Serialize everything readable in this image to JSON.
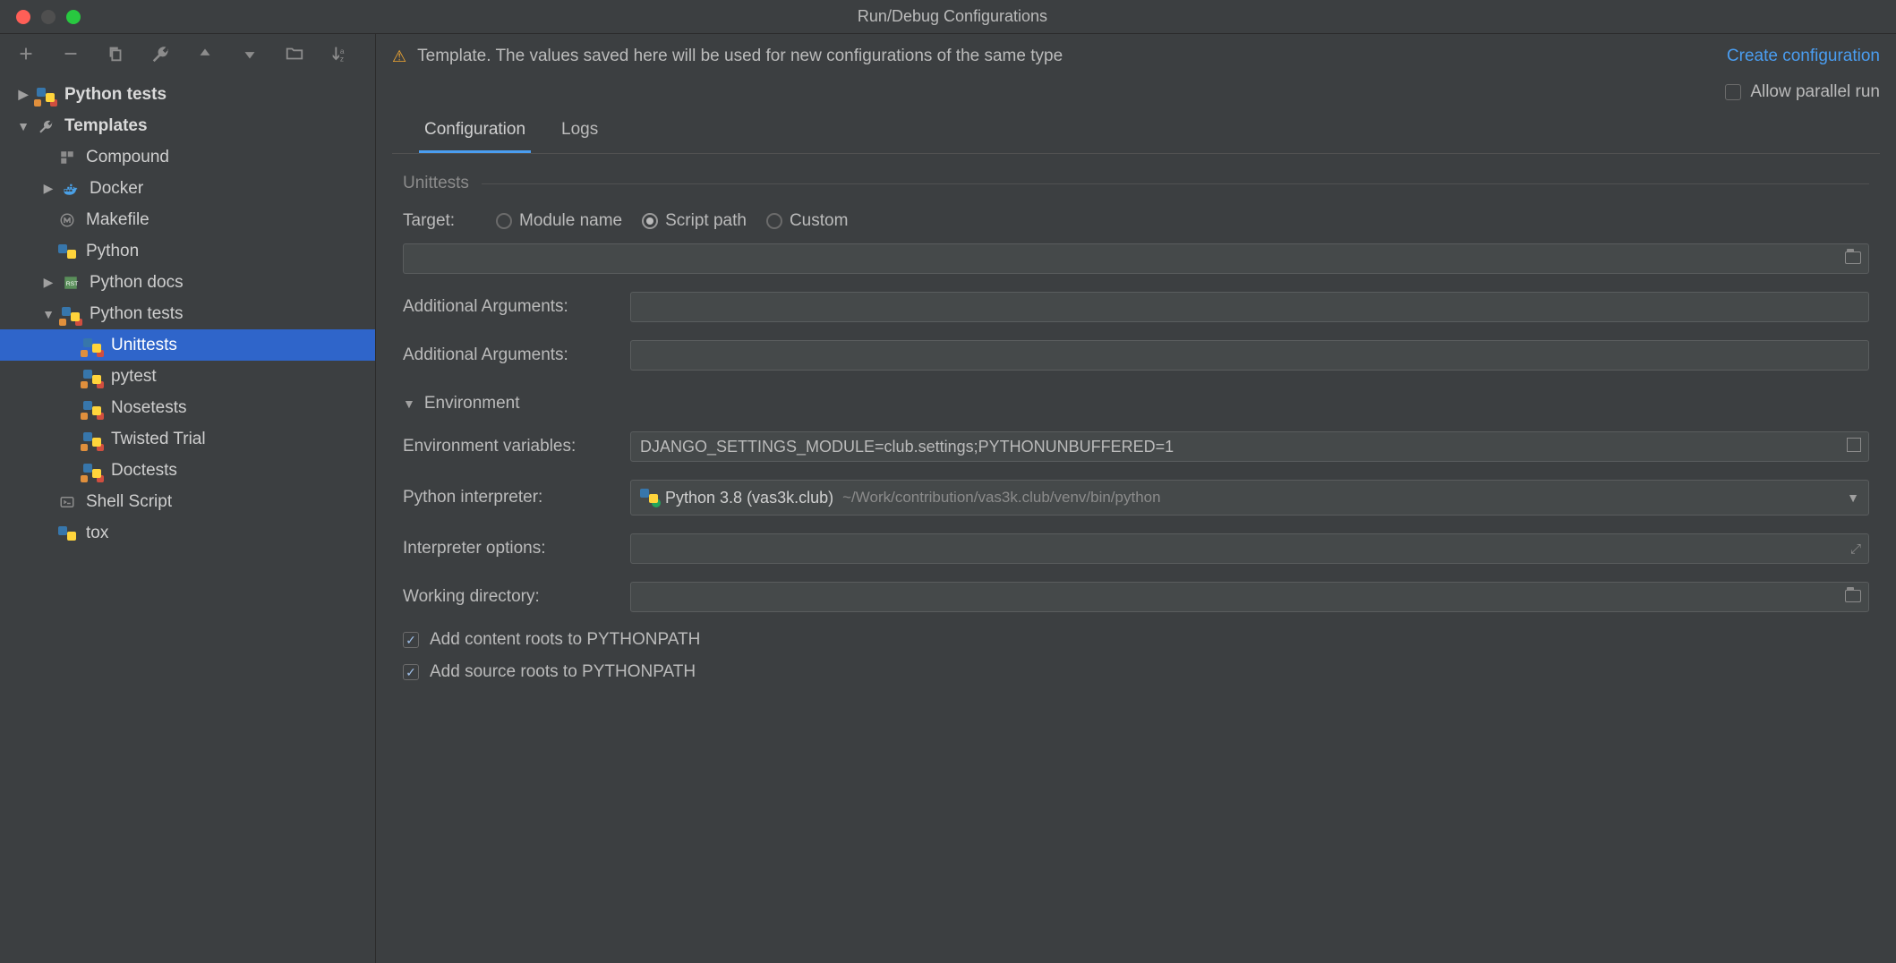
{
  "window": {
    "title": "Run/Debug Configurations"
  },
  "banner": {
    "text": "Template. The values saved here will be used for new configurations of the same type",
    "link": "Create configuration"
  },
  "allow_parallel": {
    "label": "Allow parallel run",
    "checked": false
  },
  "tabs": {
    "configuration": "Configuration",
    "logs": "Logs",
    "active": "configuration"
  },
  "tree": {
    "root": [
      {
        "label": "Python tests",
        "expandable": true,
        "expanded": false
      },
      {
        "label": "Templates",
        "expandable": true,
        "expanded": true
      }
    ],
    "templates": [
      {
        "label": "Compound",
        "icon": "compound"
      },
      {
        "label": "Docker",
        "icon": "docker",
        "expandable": true
      },
      {
        "label": "Makefile",
        "icon": "makefile"
      },
      {
        "label": "Python",
        "icon": "python"
      },
      {
        "label": "Python docs",
        "icon": "pythondocs",
        "expandable": true
      },
      {
        "label": "Python tests",
        "icon": "pythontests",
        "expandable": true,
        "expanded": true
      }
    ],
    "pytests": [
      {
        "label": "Unittests",
        "selected": true
      },
      {
        "label": "pytest"
      },
      {
        "label": "Nosetests"
      },
      {
        "label": "Twisted Trial"
      },
      {
        "label": "Doctests"
      }
    ],
    "after": [
      {
        "label": "Shell Script",
        "icon": "shell"
      },
      {
        "label": "tox",
        "icon": "tox"
      }
    ]
  },
  "form": {
    "section_title": "Unittests",
    "target_label": "Target:",
    "target_options": {
      "module": "Module name",
      "script": "Script path",
      "custom": "Custom",
      "selected": "script"
    },
    "target_value": "",
    "additional_args_label": "Additional Arguments:",
    "additional_args1": "",
    "additional_args2": "",
    "environment_header": "Environment",
    "env_vars_label": "Environment variables:",
    "env_vars_value": "DJANGO_SETTINGS_MODULE=club.settings;PYTHONUNBUFFERED=1",
    "interpreter_label": "Python interpreter:",
    "interpreter_main": "Python 3.8 (vas3k.club)",
    "interpreter_sub": "~/Work/contribution/vas3k.club/venv/bin/python",
    "interpreter_options_label": "Interpreter options:",
    "interpreter_options_value": "",
    "working_dir_label": "Working directory:",
    "working_dir_value": "",
    "cb_content_roots": "Add content roots to PYTHONPATH",
    "cb_source_roots": "Add source roots to PYTHONPATH"
  }
}
